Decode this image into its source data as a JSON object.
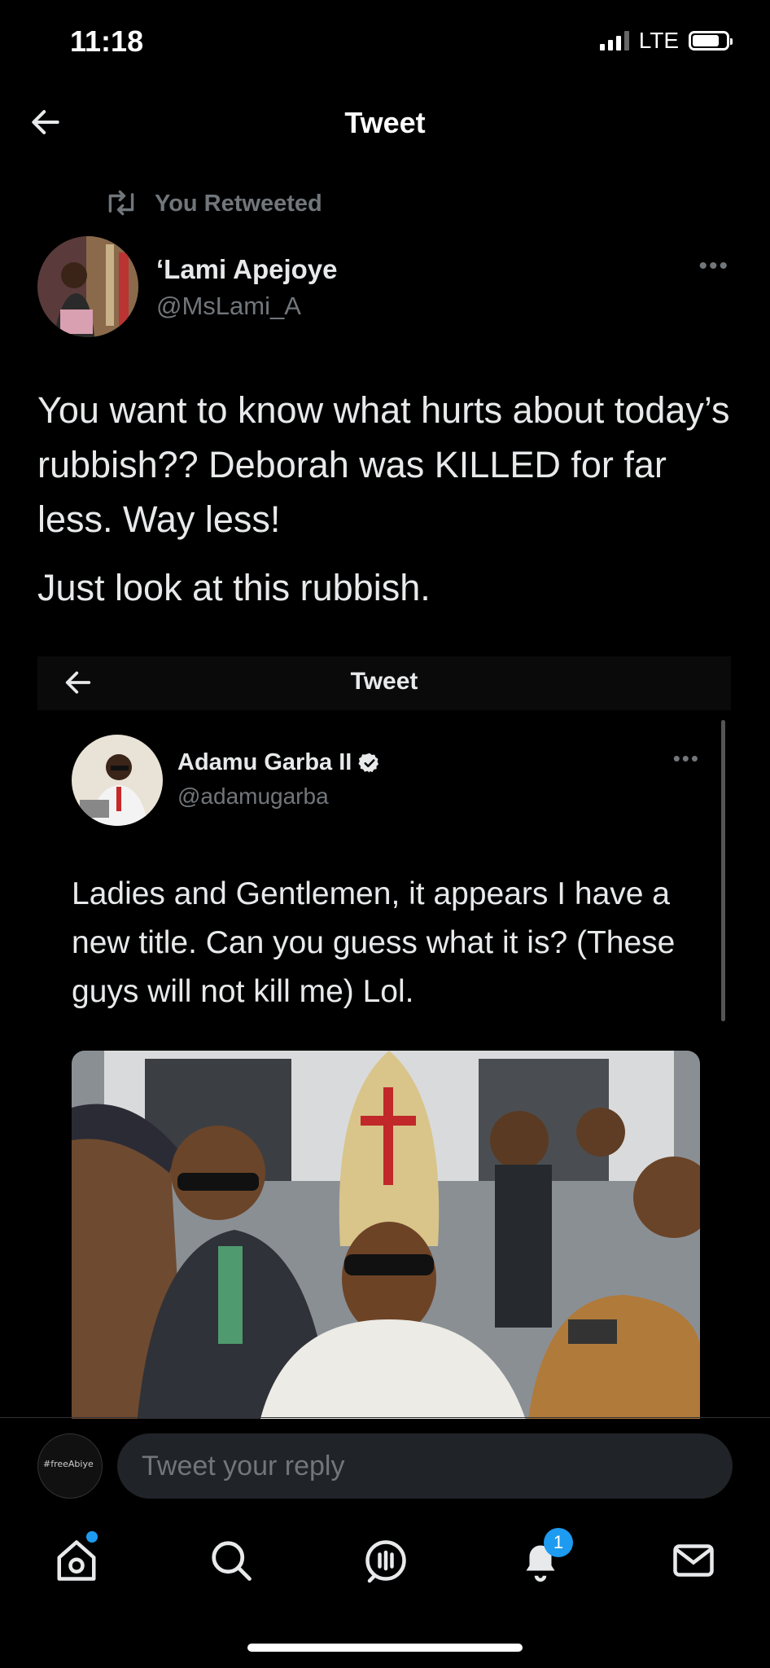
{
  "status_bar": {
    "time": "11:18",
    "network": "LTE"
  },
  "header": {
    "title": "Tweet"
  },
  "retweet": {
    "label": "You Retweeted"
  },
  "author": {
    "name": "‘Lami Apejoye",
    "handle": "@MsLami_A"
  },
  "tweet": {
    "text": "You want to know what hurts about today’s rubbish?? Deborah was KILLED for far less. Way less!",
    "text2": "Just look at this rubbish."
  },
  "embedded": {
    "header_title": "Tweet",
    "author": {
      "name": "Adamu Garba II",
      "handle": "@adamugarba",
      "verified": true
    },
    "text": "Ladies and Gentlemen, it appears I have a new title. Can you guess what it is? (These guys will not kill me) Lol."
  },
  "reply": {
    "placeholder": "Tweet your reply",
    "avatar_text": "#freeAbiye"
  },
  "tabbar": {
    "items": [
      "home-icon",
      "search-icon",
      "spaces-icon",
      "notifications-icon",
      "messages-icon"
    ],
    "notifications_count": "1"
  },
  "colors": {
    "accent": "#1d9bf0",
    "background": "#000000",
    "secondary_text": "#71767b"
  }
}
